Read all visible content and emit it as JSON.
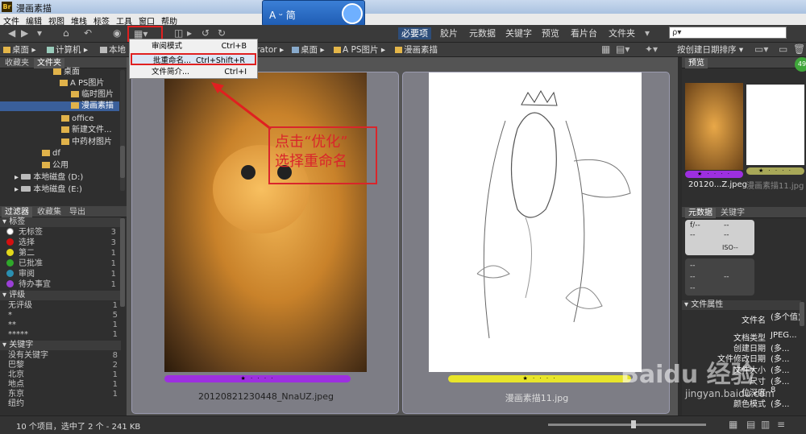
{
  "window": {
    "app_icon": "Br",
    "title": "漫画素描"
  },
  "menu": [
    "文件",
    "编辑",
    "视图",
    "堆栈",
    "标签",
    "工具",
    "窗口",
    "帮助"
  ],
  "ime": {
    "label": "A ᵕ 简"
  },
  "workspaces": [
    "必要项",
    "胶片",
    "元数据",
    "关键字",
    "预览",
    "看片台",
    "文件夹"
  ],
  "search": {
    "placeholder": "ρ▾"
  },
  "path": [
    "桌面",
    "计算机",
    "本地",
    "rator",
    "桌面",
    "A PS图片",
    "漫画素描"
  ],
  "sort_label": "按创建日期排序",
  "dropdown": [
    {
      "label": "审阅模式",
      "shortcut": "Ctrl+B"
    },
    {
      "label": "批重命名...",
      "shortcut": "Ctrl+Shift+R"
    },
    {
      "label": "文件简介...",
      "shortcut": "Ctrl+I"
    }
  ],
  "annotation": [
    "点击“优化”",
    "选择重命名"
  ],
  "left_tabs_top": [
    "收藏夹",
    "文件夹"
  ],
  "tree": [
    {
      "label": "桌面",
      "type": "folder"
    },
    {
      "label": "A PS图片",
      "type": "folder"
    },
    {
      "label": "临时图片",
      "type": "folder"
    },
    {
      "label": "漫画素描",
      "type": "folder",
      "selected": true
    },
    {
      "label": "office",
      "type": "folder"
    },
    {
      "label": "新建文件...",
      "type": "folder"
    },
    {
      "label": "中药材图片",
      "type": "folder"
    },
    {
      "label": "df",
      "type": "folder"
    },
    {
      "label": "公用",
      "type": "folder"
    },
    {
      "label": "本地磁盘 (D:)",
      "type": "drive"
    },
    {
      "label": "本地磁盘 (E:)",
      "type": "drive"
    }
  ],
  "left_tabs_bottom": [
    "过滤器",
    "收藏集",
    "导出"
  ],
  "filter": {
    "labels_title": "标签",
    "labels": [
      {
        "name": "无标签",
        "count": "3",
        "color": "#ffffff"
      },
      {
        "name": "选择",
        "count": "3",
        "color": "#d41010"
      },
      {
        "name": "第二",
        "count": "1",
        "color": "#e3d81a"
      },
      {
        "name": "已批准",
        "count": "1",
        "color": "#2fa82a"
      },
      {
        "name": "审阅",
        "count": "1",
        "color": "#2a8fb0"
      },
      {
        "name": "待办事宜",
        "count": "1",
        "color": "#9b3fd6"
      }
    ],
    "rating_title": "评级",
    "ratings": [
      {
        "name": "无评级",
        "count": "1"
      },
      {
        "name": "*",
        "count": "5"
      },
      {
        "name": "**",
        "count": "1"
      },
      {
        "name": "*****",
        "count": "1"
      }
    ],
    "keywords_title": "关键字",
    "keywords": [
      {
        "name": "没有关键字",
        "count": "8"
      },
      {
        "name": "巴黎",
        "count": "2"
      },
      {
        "name": "北京",
        "count": "1"
      },
      {
        "name": "地点",
        "count": "1"
      },
      {
        "name": "东京",
        "count": "1"
      },
      {
        "name": "纽约",
        "count": ""
      }
    ]
  },
  "thumbs": [
    {
      "name": "20120821230448_NnaUZ.jpeg",
      "rating": "★ · · · ·",
      "color": "#9d2fe0"
    },
    {
      "name": "漫画素描11.jpg",
      "rating": "★ · · · ·",
      "color": "#e8e52a"
    }
  ],
  "right": {
    "preview_tab": "预览",
    "preview_items": [
      {
        "name": "20120...Z.jpeg",
        "rating": "★ · · · ·",
        "color": "#9d2fe0"
      },
      {
        "name": "漫画素描11.jpg",
        "rating": "★ · · · ·",
        "color": "#a8a858"
      }
    ],
    "meta_tabs": [
      "元数据",
      "关键字"
    ],
    "camera": [
      "f/--",
      "--",
      "--",
      "--",
      "ISO--",
      "--",
      "--",
      "--",
      "--"
    ],
    "file_props_title": "文件属性",
    "props": [
      {
        "k": "文件名",
        "v": "(多个值)"
      },
      {
        "k": "文档类型",
        "v": "JPEG..."
      },
      {
        "k": "创建日期",
        "v": "(多..."
      },
      {
        "k": "文件修改日期",
        "v": "(多..."
      },
      {
        "k": "文件大小",
        "v": "(多..."
      },
      {
        "k": "尺寸",
        "v": "(多..."
      },
      {
        "k": "位深度",
        "v": "8"
      },
      {
        "k": "颜色模式",
        "v": "(多..."
      }
    ]
  },
  "status": "10 个项目，选中了 2 个 - 241 KB",
  "watermark": {
    "brand": "Baidu 经验",
    "url": "jingyan.baidu.com"
  },
  "badge": "49"
}
